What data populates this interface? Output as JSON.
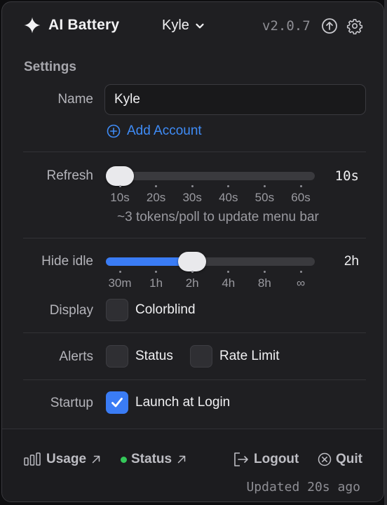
{
  "header": {
    "app_title": "AI Battery",
    "account_name": "Kyle",
    "version": "v2.0.7",
    "icons": {
      "brand": "sparkle-icon",
      "account_menu": "chevron-down-icon",
      "update": "arrow-up-circle-icon",
      "settings": "gear-icon"
    }
  },
  "settings": {
    "section_title": "Settings",
    "name_label": "Name",
    "name_value": "Kyle",
    "add_account_label": "Add Account",
    "refresh": {
      "label": "Refresh",
      "value_text": "10s",
      "ticks": [
        "10s",
        "20s",
        "30s",
        "40s",
        "50s",
        "60s"
      ],
      "selected_index": 0,
      "hint": "~3 tokens/poll to update menu bar"
    },
    "hide_idle": {
      "label": "Hide idle",
      "value_text": "2h",
      "ticks": [
        "30m",
        "1h",
        "2h",
        "4h",
        "8h",
        "∞"
      ],
      "selected_index": 2
    },
    "display": {
      "label": "Display",
      "colorblind_label": "Colorblind",
      "colorblind_checked": false
    },
    "alerts": {
      "label": "Alerts",
      "status_label": "Status",
      "status_checked": false,
      "rate_limit_label": "Rate Limit",
      "rate_limit_checked": false
    },
    "startup": {
      "label": "Startup",
      "launch_label": "Launch at Login",
      "launch_checked": true
    }
  },
  "footer": {
    "usage_label": "Usage",
    "status_label": "Status",
    "logout_label": "Logout",
    "quit_label": "Quit",
    "updated_text": "Updated 20s ago",
    "status_color": "#34c759"
  },
  "colors": {
    "accent": "#3a7cf5",
    "link": "#3f8cf7",
    "panel": "#1f1f22"
  }
}
